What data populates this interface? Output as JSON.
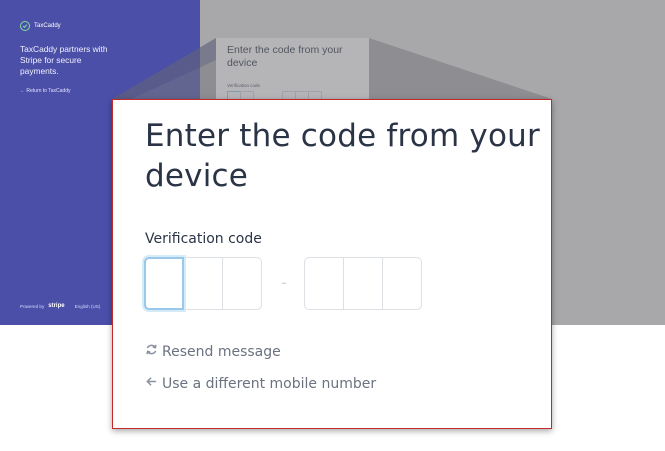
{
  "brand": {
    "name": "TaxCaddy"
  },
  "sidebar": {
    "partner_text": "TaxCaddy partners with Stripe for secure payments.",
    "return_link": "← Return to TaxCaddy",
    "footer": {
      "powered_by": "Powered by",
      "stripe": "stripe",
      "locale": "English (US)"
    }
  },
  "preview": {
    "title": "Enter the code from your device",
    "label": "Verification code"
  },
  "verification": {
    "title": "Enter the code from your device",
    "label": "Verification code",
    "separator": "-",
    "code_digits": [
      "",
      "",
      "",
      "",
      "",
      ""
    ],
    "resend_label": "Resend message",
    "different_number_label": "Use a different mobile number"
  },
  "colors": {
    "sidebar_bg": "#4b4fa8",
    "overlay_gray": "#a8a8aa",
    "zoom_border": "#c42a2a",
    "focus_ring": "#9ac8ea",
    "link_gray": "#6b7280"
  },
  "icons": {
    "brand": "checkmark-circle-icon",
    "resend": "refresh-icon",
    "back": "arrow-left-icon"
  }
}
